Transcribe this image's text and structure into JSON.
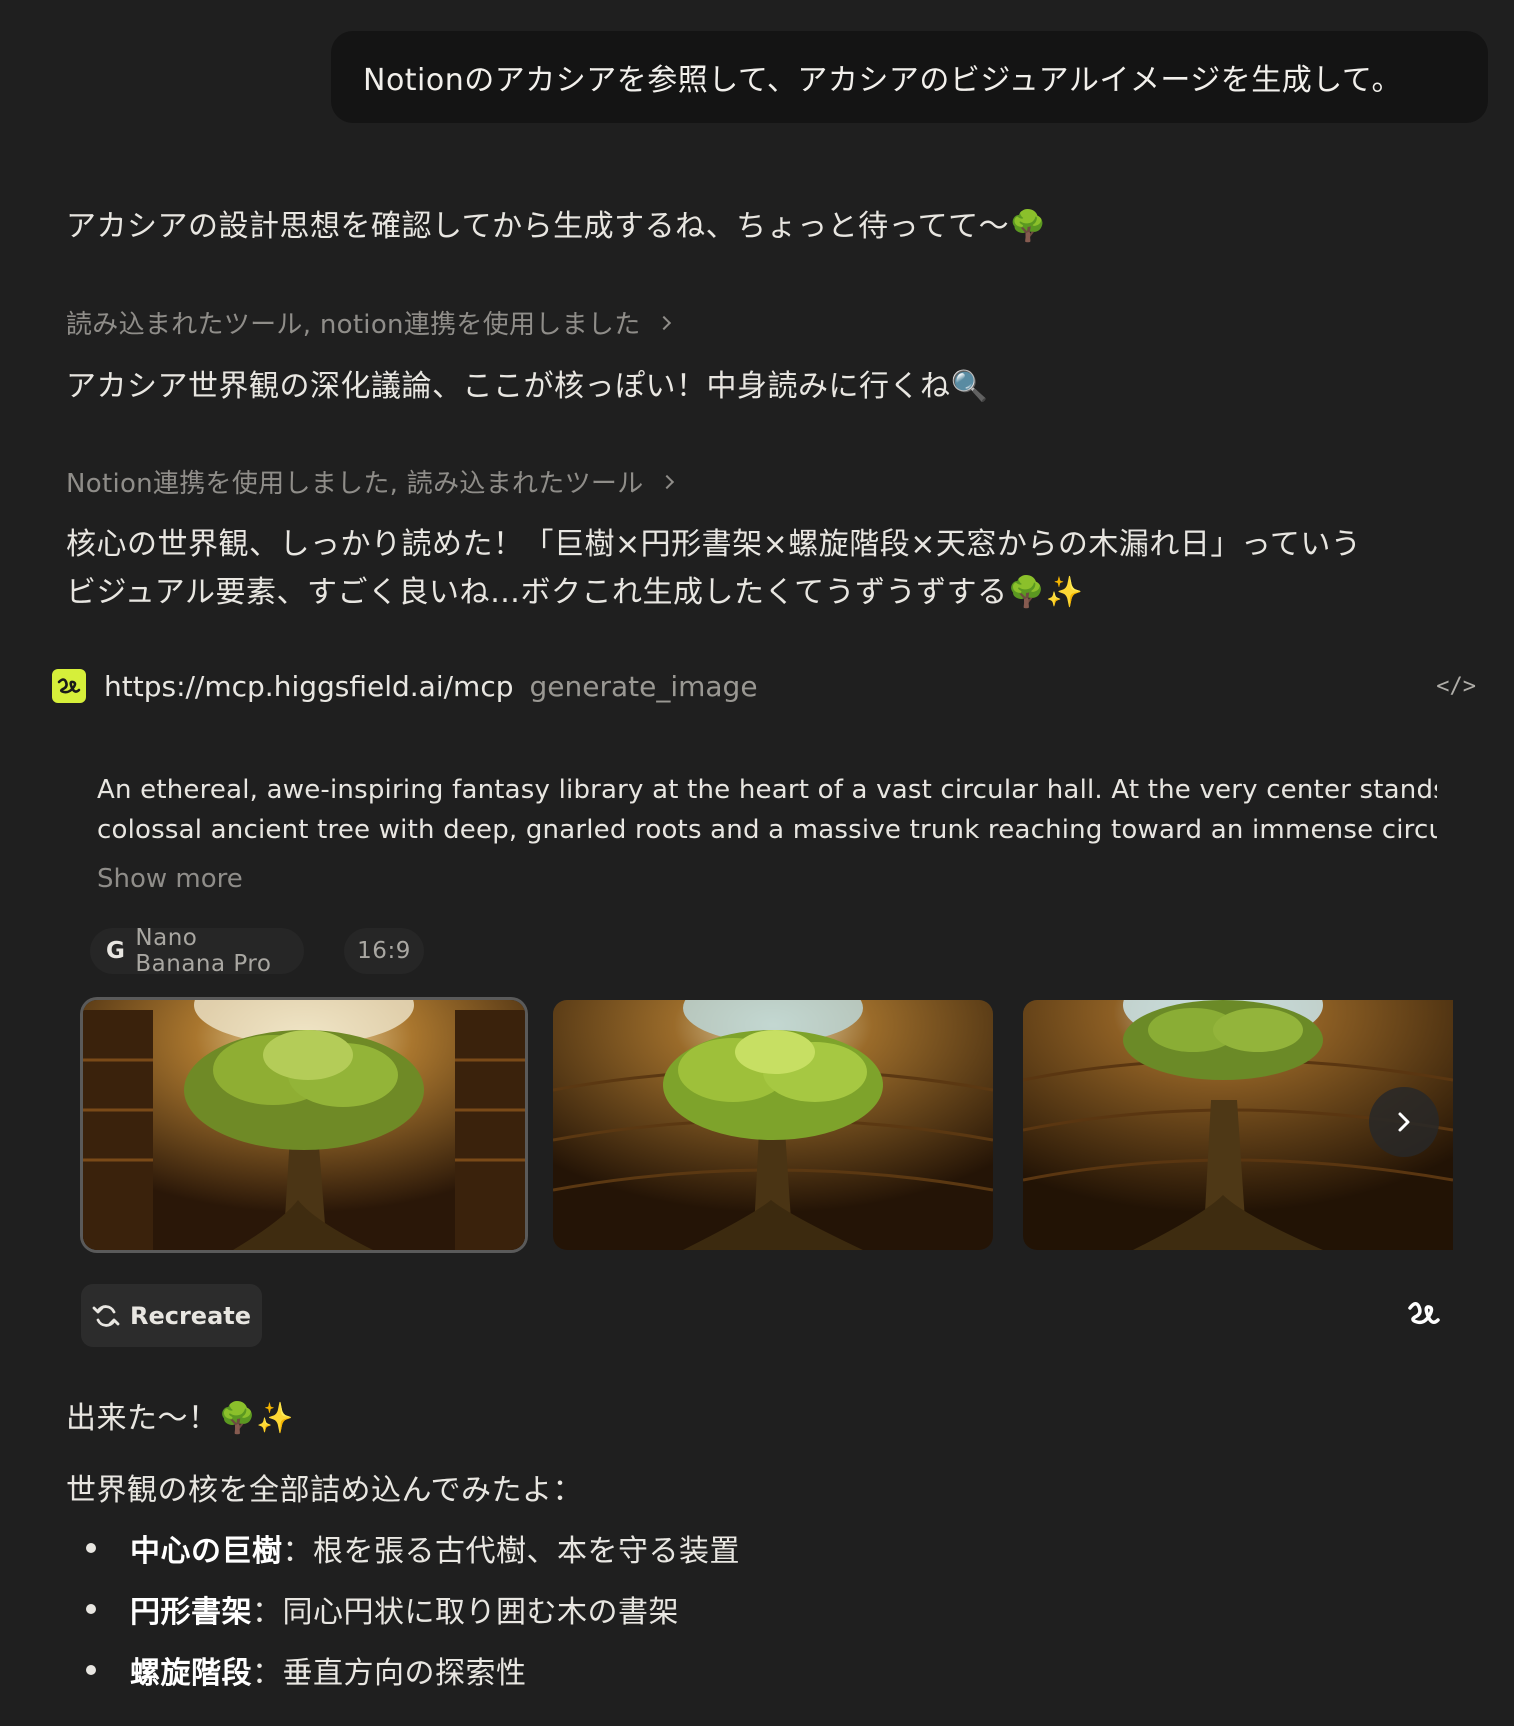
{
  "user_message": "Notionのアカシアを参照して、アカシアのビジュアルイメージを生成して。",
  "assistant": {
    "intro": "アカシアの設計思想を確認してから生成するね、ちょっと待ってて〜🌳",
    "tool_step_1": "読み込まれたツール, notion連携を使用しました",
    "para_2": "アカシア世界観の深化議論、ここが核っぽい！中身読みに行くね🔍",
    "tool_step_2": "Notion連携を使用しました, 読み込まれたツール",
    "para_3_line1": "核心の世界観、しっかり読めた！「巨樹×円形書架×螺旋階段×天窓からの木漏れ日」っていう",
    "para_3_line2": "ビジュアル要素、すごく良いね…ボクこれ生成したくてうずうずする🌳✨",
    "mcp": {
      "url": "https://mcp.higgsfield.ai/mcp",
      "function": "generate_image",
      "code_toggle": "</>",
      "prompt_line1": "An ethereal, awe-inspiring fantasy library at the heart of a vast circular hall. At the very center stands a",
      "prompt_line2": "colossal ancient tree with deep, gnarled roots and a massive trunk reaching toward an immense circul...",
      "show_more": "Show more",
      "model": "Nano Banana Pro",
      "model_icon": "G",
      "aspect_ratio": "16:9",
      "recreate_label": "Recreate",
      "images": [
        "generated-image-1",
        "generated-image-2",
        "generated-image-3"
      ]
    },
    "done": "出来た〜！🌳✨",
    "summary_intro": "世界観の核を全部詰め込んでみたよ：",
    "bullets": [
      {
        "term": "中心の巨樹",
        "desc": "：根を張る古代樹、本を守る装置"
      },
      {
        "term": "円形書架",
        "desc": "：同心円状に取り囲む木の書架"
      },
      {
        "term": "螺旋階段",
        "desc": "：垂直方向の探索性"
      }
    ]
  },
  "colors": {
    "background": "#1f1f1f",
    "user_bubble": "#141414",
    "muted_text": "#8f8d89",
    "higgsfield_accent": "#d6ef3a"
  }
}
